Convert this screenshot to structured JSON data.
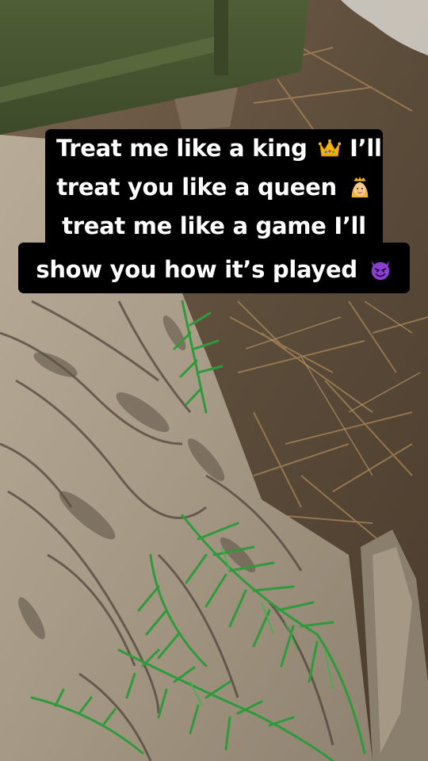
{
  "caption": {
    "lines": [
      {
        "before": "Treat me like a king",
        "emoji": "crown-icon",
        "after": "I’ll"
      },
      {
        "before": "treat you like a queen",
        "emoji": "princess-icon",
        "after": ""
      },
      {
        "before": "treat me like a game I’ll",
        "emoji": "",
        "after": ""
      },
      {
        "before": "show you how it’s played",
        "emoji": "smiling-devil-icon",
        "after": ""
      }
    ]
  },
  "colors": {
    "caption_bg": "#000000",
    "caption_text": "#ffffff",
    "camo_green": "#3c8a3c",
    "wood_green": "#4a5a33",
    "forest_floor": "#6b5a44"
  }
}
